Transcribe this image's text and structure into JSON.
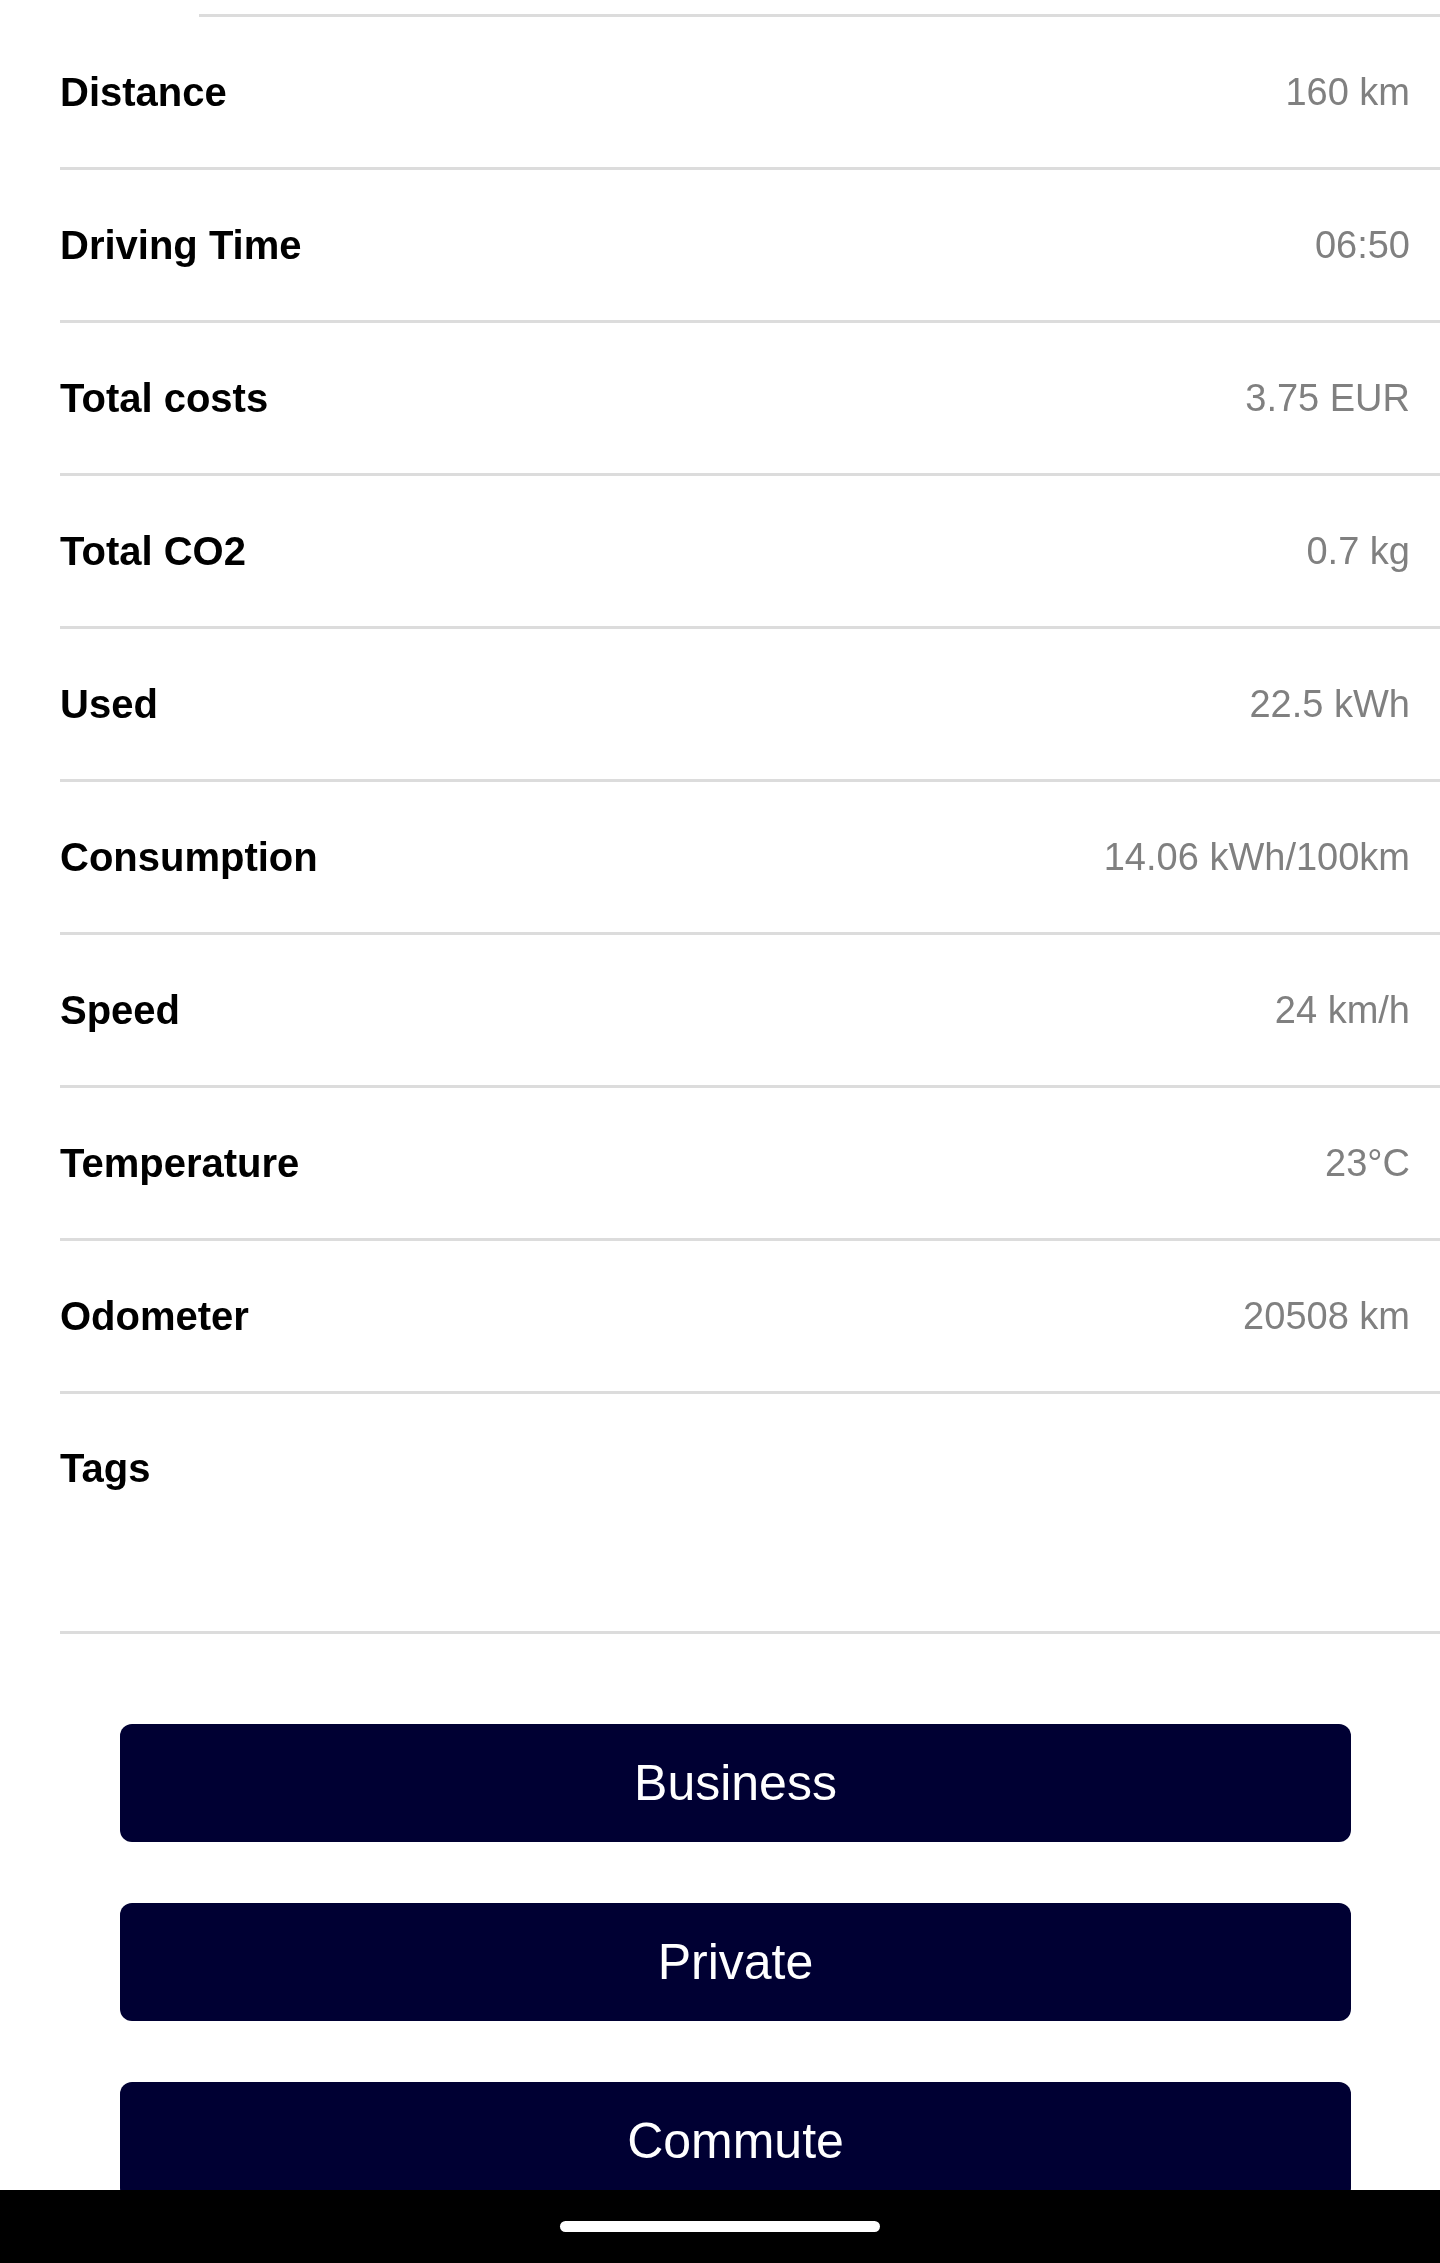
{
  "details": [
    {
      "label": "Distance",
      "value": "160 km"
    },
    {
      "label": "Driving Time",
      "value": "06:50"
    },
    {
      "label": "Total costs",
      "value": "3.75 EUR"
    },
    {
      "label": "Total CO2",
      "value": "0.7 kg"
    },
    {
      "label": "Used",
      "value": "22.5 kWh"
    },
    {
      "label": "Consumption",
      "value": "14.06 kWh/100km"
    },
    {
      "label": "Speed",
      "value": "24 km/h"
    },
    {
      "label": "Temperature",
      "value": "23°C"
    },
    {
      "label": "Odometer",
      "value": "20508 km"
    }
  ],
  "tags": {
    "label": "Tags"
  },
  "buttons": [
    "Business",
    "Private",
    "Commute"
  ]
}
